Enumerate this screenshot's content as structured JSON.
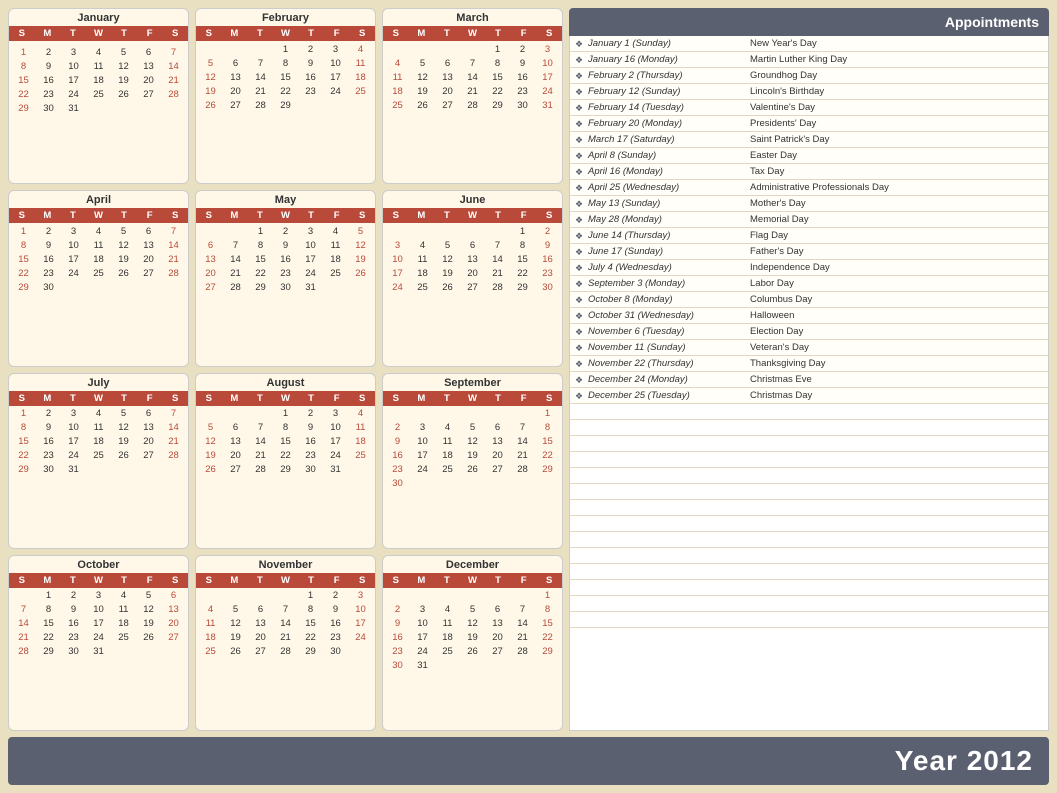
{
  "title": "Year 2012",
  "appointmentsHeader": "Appointments",
  "dayHeaders": [
    "S",
    "M",
    "T",
    "W",
    "T",
    "F",
    "S"
  ],
  "months": [
    {
      "name": "January",
      "weeks": [
        [
          "",
          "",
          "",
          "",
          "",
          "",
          ""
        ],
        [
          "1",
          "2",
          "3",
          "4",
          "5",
          "6",
          "7"
        ],
        [
          "8",
          "9",
          "10",
          "11",
          "12",
          "13",
          "14"
        ],
        [
          "15",
          "16",
          "17",
          "18",
          "19",
          "20",
          "21"
        ],
        [
          "22",
          "23",
          "24",
          "25",
          "26",
          "27",
          "28"
        ],
        [
          "29",
          "30",
          "31",
          "",
          "",
          "",
          ""
        ]
      ]
    },
    {
      "name": "February",
      "weeks": [
        [
          "",
          "",
          "",
          "1",
          "2",
          "3",
          "4"
        ],
        [
          "5",
          "6",
          "7",
          "8",
          "9",
          "10",
          "11"
        ],
        [
          "12",
          "13",
          "14",
          "15",
          "16",
          "17",
          "18"
        ],
        [
          "19",
          "20",
          "21",
          "22",
          "23",
          "24",
          "25"
        ],
        [
          "26",
          "27",
          "28",
          "29",
          "",
          "",
          ""
        ],
        [
          "",
          "",
          "",
          "",
          "",
          "",
          ""
        ]
      ]
    },
    {
      "name": "March",
      "weeks": [
        [
          "",
          "",
          "",
          "",
          "1",
          "2",
          "3"
        ],
        [
          "4",
          "5",
          "6",
          "7",
          "8",
          "9",
          "10"
        ],
        [
          "11",
          "12",
          "13",
          "14",
          "15",
          "16",
          "17"
        ],
        [
          "18",
          "19",
          "20",
          "21",
          "22",
          "23",
          "24"
        ],
        [
          "25",
          "26",
          "27",
          "28",
          "29",
          "30",
          "31"
        ],
        [
          "",
          "",
          "",
          "",
          "",
          "",
          ""
        ]
      ]
    },
    {
      "name": "April",
      "weeks": [
        [
          "1",
          "2",
          "3",
          "4",
          "5",
          "6",
          "7"
        ],
        [
          "8",
          "9",
          "10",
          "11",
          "12",
          "13",
          "14"
        ],
        [
          "15",
          "16",
          "17",
          "18",
          "19",
          "20",
          "21"
        ],
        [
          "22",
          "23",
          "24",
          "25",
          "26",
          "27",
          "28"
        ],
        [
          "29",
          "30",
          "",
          "",
          "",
          "",
          ""
        ],
        [
          "",
          "",
          "",
          "",
          "",
          "",
          ""
        ]
      ]
    },
    {
      "name": "May",
      "weeks": [
        [
          "",
          "",
          "1",
          "2",
          "3",
          "4",
          "5"
        ],
        [
          "6",
          "7",
          "8",
          "9",
          "10",
          "11",
          "12"
        ],
        [
          "13",
          "14",
          "15",
          "16",
          "17",
          "18",
          "19"
        ],
        [
          "20",
          "21",
          "22",
          "23",
          "24",
          "25",
          "26"
        ],
        [
          "27",
          "28",
          "29",
          "30",
          "31",
          "",
          ""
        ],
        [
          "",
          "",
          "",
          "",
          "",
          "",
          ""
        ]
      ]
    },
    {
      "name": "June",
      "weeks": [
        [
          "",
          "",
          "",
          "",
          "",
          "1",
          "2"
        ],
        [
          "3",
          "4",
          "5",
          "6",
          "7",
          "8",
          "9"
        ],
        [
          "10",
          "11",
          "12",
          "13",
          "14",
          "15",
          "16"
        ],
        [
          "17",
          "18",
          "19",
          "20",
          "21",
          "22",
          "23"
        ],
        [
          "24",
          "25",
          "26",
          "27",
          "28",
          "29",
          "30"
        ],
        [
          "",
          "",
          "",
          "",
          "",
          "",
          ""
        ]
      ]
    },
    {
      "name": "July",
      "weeks": [
        [
          "1",
          "2",
          "3",
          "4",
          "5",
          "6",
          "7"
        ],
        [
          "8",
          "9",
          "10",
          "11",
          "12",
          "13",
          "14"
        ],
        [
          "15",
          "16",
          "17",
          "18",
          "19",
          "20",
          "21"
        ],
        [
          "22",
          "23",
          "24",
          "25",
          "26",
          "27",
          "28"
        ],
        [
          "29",
          "30",
          "31",
          "",
          "",
          "",
          ""
        ],
        [
          "",
          "",
          "",
          "",
          "",
          "",
          ""
        ]
      ]
    },
    {
      "name": "August",
      "weeks": [
        [
          "",
          "",
          "",
          "1",
          "2",
          "3",
          "4"
        ],
        [
          "5",
          "6",
          "7",
          "8",
          "9",
          "10",
          "11"
        ],
        [
          "12",
          "13",
          "14",
          "15",
          "16",
          "17",
          "18"
        ],
        [
          "19",
          "20",
          "21",
          "22",
          "23",
          "24",
          "25"
        ],
        [
          "26",
          "27",
          "28",
          "29",
          "30",
          "31",
          ""
        ],
        [
          "",
          "",
          "",
          "",
          "",
          "",
          ""
        ]
      ]
    },
    {
      "name": "September",
      "weeks": [
        [
          "",
          "",
          "",
          "",
          "",
          "",
          "1"
        ],
        [
          "2",
          "3",
          "4",
          "5",
          "6",
          "7",
          "8"
        ],
        [
          "9",
          "10",
          "11",
          "12",
          "13",
          "14",
          "15"
        ],
        [
          "16",
          "17",
          "18",
          "19",
          "20",
          "21",
          "22"
        ],
        [
          "23",
          "24",
          "25",
          "26",
          "27",
          "28",
          "29"
        ],
        [
          "30",
          "",
          "",
          "",
          "",
          "",
          ""
        ]
      ]
    },
    {
      "name": "October",
      "weeks": [
        [
          "",
          "1",
          "2",
          "3",
          "4",
          "5",
          "6"
        ],
        [
          "7",
          "8",
          "9",
          "10",
          "11",
          "12",
          "13"
        ],
        [
          "14",
          "15",
          "16",
          "17",
          "18",
          "19",
          "20"
        ],
        [
          "21",
          "22",
          "23",
          "24",
          "25",
          "26",
          "27"
        ],
        [
          "28",
          "29",
          "30",
          "31",
          "",
          "",
          ""
        ],
        [
          "",
          "",
          "",
          "",
          "",
          "",
          ""
        ]
      ]
    },
    {
      "name": "November",
      "weeks": [
        [
          "",
          "",
          "",
          "",
          "1",
          "2",
          "3"
        ],
        [
          "4",
          "5",
          "6",
          "7",
          "8",
          "9",
          "10"
        ],
        [
          "11",
          "12",
          "13",
          "14",
          "15",
          "16",
          "17"
        ],
        [
          "18",
          "19",
          "20",
          "21",
          "22",
          "23",
          "24"
        ],
        [
          "25",
          "26",
          "27",
          "28",
          "29",
          "30",
          ""
        ],
        [
          "",
          "",
          "",
          "",
          "",
          "",
          ""
        ]
      ]
    },
    {
      "name": "December",
      "weeks": [
        [
          "",
          "",
          "",
          "",
          "",
          "",
          "1"
        ],
        [
          "2",
          "3",
          "4",
          "5",
          "6",
          "7",
          "8"
        ],
        [
          "9",
          "10",
          "11",
          "12",
          "13",
          "14",
          "15"
        ],
        [
          "16",
          "17",
          "18",
          "19",
          "20",
          "21",
          "22"
        ],
        [
          "23",
          "24",
          "25",
          "26",
          "27",
          "28",
          "29"
        ],
        [
          "30",
          "31",
          "",
          "",
          "",
          "",
          ""
        ]
      ]
    }
  ],
  "holidays": [
    {
      "date": "January 1 (Sunday)",
      "name": "New Year's Day"
    },
    {
      "date": "January 16 (Monday)",
      "name": "Martin Luther King Day"
    },
    {
      "date": "February 2 (Thursday)",
      "name": "Groundhog Day"
    },
    {
      "date": "February 12 (Sunday)",
      "name": "Lincoln's Birthday"
    },
    {
      "date": "February 14 (Tuesday)",
      "name": "Valentine's Day"
    },
    {
      "date": "February 20 (Monday)",
      "name": "Presidents' Day"
    },
    {
      "date": "March 17 (Saturday)",
      "name": "Saint Patrick's Day"
    },
    {
      "date": "April 8 (Sunday)",
      "name": "Easter Day"
    },
    {
      "date": "April 16 (Monday)",
      "name": "Tax Day"
    },
    {
      "date": "April 25 (Wednesday)",
      "name": "Administrative Professionals Day"
    },
    {
      "date": "May 13 (Sunday)",
      "name": "Mother's Day"
    },
    {
      "date": "May 28 (Monday)",
      "name": "Memorial Day"
    },
    {
      "date": "June 14 (Thursday)",
      "name": "Flag Day"
    },
    {
      "date": "June 17 (Sunday)",
      "name": "Father's Day"
    },
    {
      "date": "July 4 (Wednesday)",
      "name": "Independence Day"
    },
    {
      "date": "September 3 (Monday)",
      "name": "Labor Day"
    },
    {
      "date": "October 8 (Monday)",
      "name": "Columbus Day"
    },
    {
      "date": "October 31 (Wednesday)",
      "name": "Halloween"
    },
    {
      "date": "November 6 (Tuesday)",
      "name": "Election Day"
    },
    {
      "date": "November 11 (Sunday)",
      "name": "Veteran's Day"
    },
    {
      "date": "November 22 (Thursday)",
      "name": "Thanksgiving Day"
    },
    {
      "date": "December 24 (Monday)",
      "name": "Christmas Eve"
    },
    {
      "date": "December 25 (Tuesday)",
      "name": "Christmas Day"
    }
  ]
}
